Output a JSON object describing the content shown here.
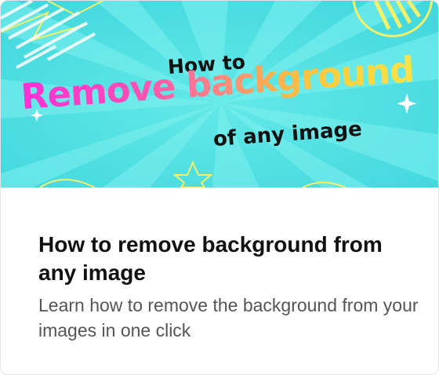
{
  "banner": {
    "line1": "How to",
    "line2": "Remove background",
    "line3": "of any image"
  },
  "card": {
    "title": "How to remove background from any image",
    "description": "Learn how to remove the background from your images in one click"
  },
  "colors": {
    "banner_background": "#4fdde0",
    "title_text": "#111111",
    "description_text": "#555555"
  }
}
